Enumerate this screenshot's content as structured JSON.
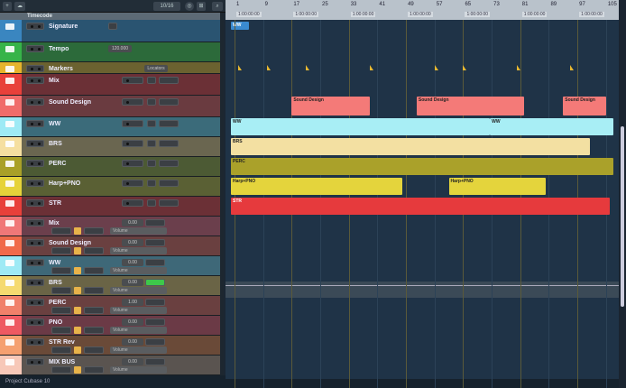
{
  "toolbar": {
    "zoom": "10/16"
  },
  "timecode_header": "Timecode",
  "tracks": [
    {
      "name": "Signature",
      "type": "ruler",
      "bg": "#2a5471",
      "strip": "#3a86c0",
      "h": 25
    },
    {
      "name": "Tempo",
      "type": "ruler",
      "bg": "#2c6a3a",
      "strip": "#37b449",
      "h": 22,
      "value": "120.000"
    },
    {
      "name": "Markers",
      "type": "ruler",
      "bg": "#6b6230",
      "strip": "#e6b42c",
      "h": 13,
      "value": "Locators"
    },
    {
      "name": "Mix",
      "type": "folder",
      "bg": "#6b3036",
      "strip": "#e8403a",
      "h": 24
    },
    {
      "name": "Sound Design",
      "type": "folder",
      "bg": "#6a3b40",
      "strip": "#f06c6a",
      "h": 24
    },
    {
      "name": "WW",
      "type": "folder",
      "bg": "#3b6b7a",
      "strip": "#9eeaf5",
      "h": 22
    },
    {
      "name": "BRS",
      "type": "folder",
      "bg": "#6a6650",
      "strip": "#f5dfa0",
      "h": 22
    },
    {
      "name": "PERC",
      "type": "folder",
      "bg": "#4c5a34",
      "strip": "#a9a028",
      "h": 22
    },
    {
      "name": "Harp+PNO",
      "type": "folder",
      "bg": "#5a6034",
      "strip": "#e6d33a",
      "h": 22
    },
    {
      "name": "STR",
      "type": "folder",
      "bg": "#6b3036",
      "strip": "#e8403a",
      "h": 22
    },
    {
      "name": "Mix",
      "type": "audio",
      "bg": "#6b3f4c",
      "strip": "#f07878",
      "h": 22,
      "value": "0.00",
      "vol": "Volume"
    },
    {
      "name": "Sound Design",
      "type": "audio",
      "bg": "#6a4040",
      "strip": "#f06a4a",
      "h": 22,
      "value": "0.00",
      "vol": "Volume"
    },
    {
      "name": "WW",
      "type": "audio",
      "bg": "#3e6878",
      "strip": "#9eeaf5",
      "h": 22,
      "value": "0.00",
      "vol": "Volume"
    },
    {
      "name": "BRS",
      "type": "audio",
      "bg": "#6a6446",
      "strip": "#f5da70",
      "h": 22,
      "value": "0.00",
      "vol": "Volume",
      "active": true
    },
    {
      "name": "PERC",
      "type": "audio",
      "bg": "#6a4040",
      "strip": "#f0806a",
      "h": 22,
      "value": "1.00",
      "vol": "Volume"
    },
    {
      "name": "PNO",
      "type": "audio",
      "bg": "#6b3a46",
      "strip": "#ee5a62",
      "h": 22,
      "value": "0.00",
      "vol": "Volume"
    },
    {
      "name": "STR Rev",
      "type": "audio",
      "bg": "#6a4a38",
      "strip": "#f5a070",
      "h": 22,
      "value": "0.00",
      "vol": "Volume"
    },
    {
      "name": "MIX BUS",
      "type": "audio",
      "bg": "#5a5450",
      "strip": "#f7c8b8",
      "h": 22,
      "value": "0.00",
      "vol": "Volume"
    }
  ],
  "status": "Project Cubase 10",
  "ruler": {
    "bars": [
      "1",
      "9",
      "17",
      "25",
      "33",
      "41",
      "49",
      "57",
      "65",
      "73",
      "81",
      "89",
      "97",
      "105"
    ],
    "time": "1:00:00:00"
  },
  "timecode_event": "WW",
  "markers": [
    2,
    10,
    21,
    39,
    57,
    65,
    80,
    95
  ],
  "events": [
    {
      "track": 4,
      "label": "Sound Design",
      "start": 18,
      "end": 39,
      "color": "#f47a78"
    },
    {
      "track": 4,
      "label": "Sound Design",
      "start": 53,
      "end": 82,
      "color": "#f47a78"
    },
    {
      "track": 4,
      "label": "Sound Design",
      "start": 94,
      "end": 105,
      "color": "#f47a78"
    },
    {
      "track": 5,
      "label": "WW",
      "start": 0,
      "end": 72.5,
      "color": "#a8eef5"
    },
    {
      "track": 5,
      "label": "WW",
      "start": 73.5,
      "end": 108,
      "color": "#a8eef5"
    },
    {
      "track": 6,
      "label": "BRS",
      "start": 0,
      "end": 100.5,
      "color": "#f3e0a2"
    },
    {
      "track": 7,
      "label": "PERC",
      "start": 0,
      "end": 108,
      "color": "#aaa12a"
    },
    {
      "track": 8,
      "label": "Harp+PNO",
      "start": 0,
      "end": 48,
      "color": "#e4d43c"
    },
    {
      "track": 8,
      "label": "Harp+PNO",
      "start": 62,
      "end": 88,
      "color": "#e4d43c"
    },
    {
      "track": 9,
      "label": "STR",
      "start": 0,
      "end": 106,
      "color": "#e63a3d"
    }
  ]
}
